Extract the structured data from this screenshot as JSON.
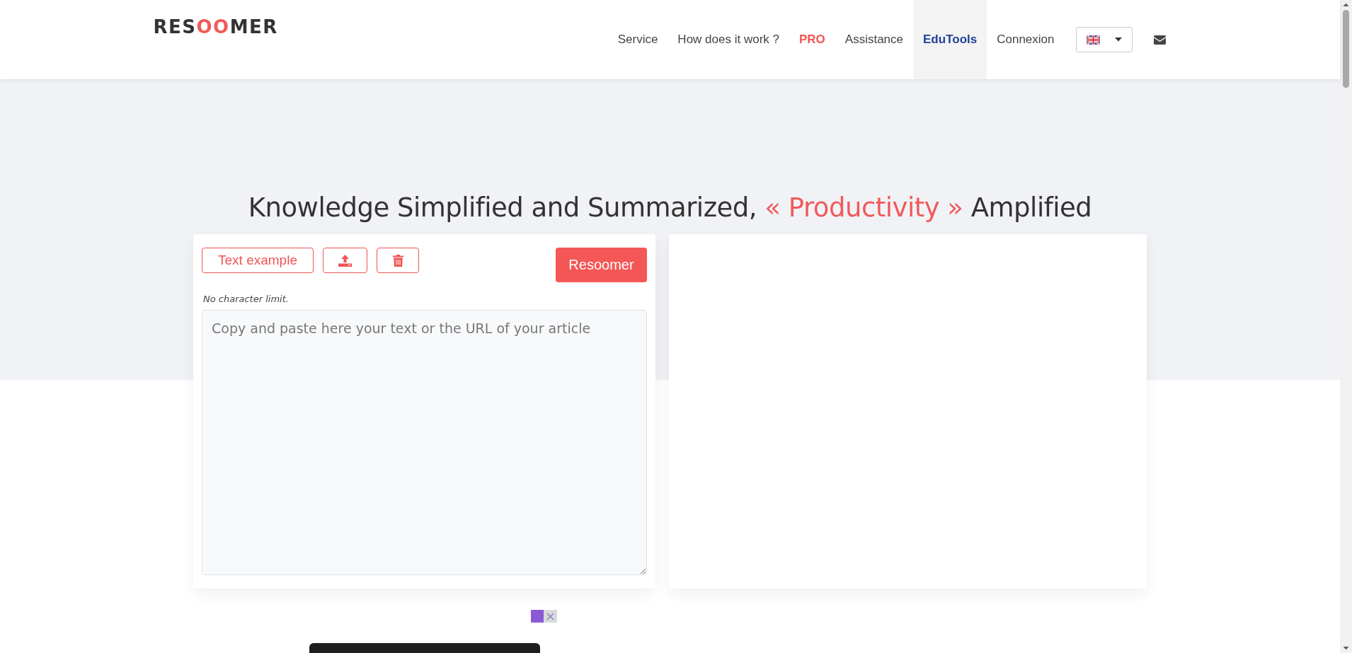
{
  "header": {
    "logo": [
      {
        "text": "RES",
        "accent": false
      },
      {
        "text": "OO",
        "accent": true
      },
      {
        "text": "MER",
        "accent": false
      }
    ],
    "nav": [
      {
        "label": "Service",
        "kind": "plain",
        "selected": false
      },
      {
        "label": "How does it work ?",
        "kind": "plain",
        "selected": false
      },
      {
        "label": "PRO",
        "kind": "highlight",
        "selected": false
      },
      {
        "label": "Assistance",
        "kind": "plain",
        "selected": false
      },
      {
        "label": "EduTools",
        "kind": "plain",
        "selected": true
      },
      {
        "label": "Connexion",
        "kind": "plain",
        "selected": false
      }
    ]
  },
  "hero": {
    "heading": "Knowledge Simplified and Summarized, *« Productivity »* Amplified"
  },
  "editor": {
    "buttons": [
      {
        "kind": "text",
        "label": "Text example"
      },
      {
        "kind": "upload"
      },
      {
        "kind": "delete"
      }
    ],
    "submit": "Resoomer",
    "note": "No character limit.",
    "placeholder": "Copy and paste here your text or the URL of your article"
  }
}
